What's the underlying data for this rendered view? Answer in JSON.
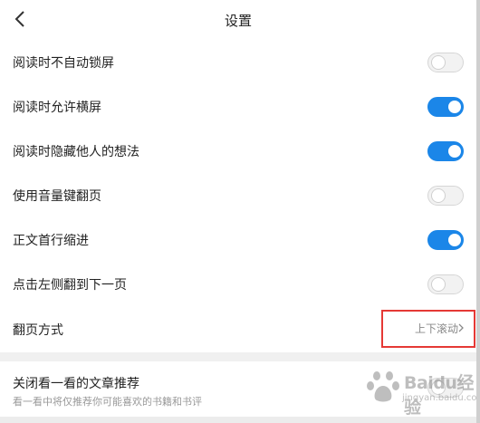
{
  "header": {
    "title": "设置"
  },
  "settings": {
    "items": [
      {
        "label": "阅读时不自动锁屏",
        "on": false
      },
      {
        "label": "阅读时允许横屏",
        "on": true
      },
      {
        "label": "阅读时隐藏他人的想法",
        "on": true
      },
      {
        "label": "使用音量键翻页",
        "on": false
      },
      {
        "label": "正文首行缩进",
        "on": true
      },
      {
        "label": "点击左侧翻到下一页",
        "on": false
      }
    ],
    "page_turn": {
      "label": "翻页方式",
      "value": "上下滚动"
    },
    "recommend": {
      "label": "关闭看一看的文章推荐",
      "sublabel": "看一看中将仅推荐你可能喜欢的书籍和书评",
      "on": false
    }
  },
  "watermark": {
    "text": "Baidu经验",
    "sub": "jingyan.baidu.com"
  },
  "colors": {
    "toggle_on": "#1b86e8",
    "highlight": "#e53935"
  }
}
